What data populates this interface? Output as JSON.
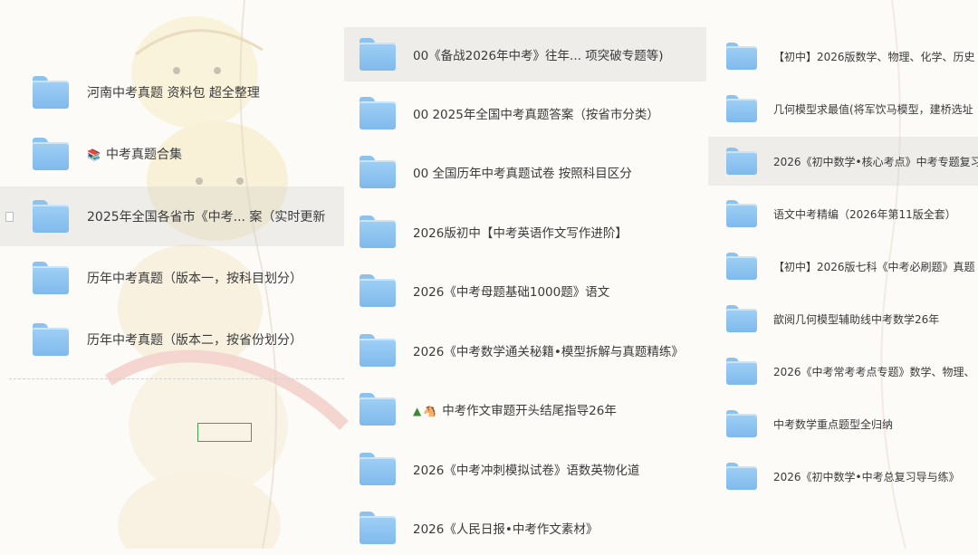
{
  "column1": {
    "items": [
      {
        "label": "河南中考真题 资料包  超全整理",
        "selected": false
      },
      {
        "label": "中考真题合集",
        "icon": "books-emoji",
        "selected": false
      },
      {
        "label": "2025年全国各省市《中考...  案（实时更新",
        "selected": true
      },
      {
        "label": "历年中考真题（版本一，按科目划分）",
        "selected": false
      },
      {
        "label": "历年中考真题（版本二，按省份划分）",
        "selected": false
      }
    ]
  },
  "column2": {
    "items": [
      {
        "label": "00《备战2026年中考》往年...  项突破专题等)",
        "selected": true
      },
      {
        "label": "00  2025年全国中考真题答案（按省市分类）",
        "selected": false
      },
      {
        "label": "00  全国历年中考真题试卷  按照科目区分",
        "selected": false
      },
      {
        "label": "2026版初中【中考英语作文写作进阶】",
        "selected": false
      },
      {
        "label": "2026《中考母题基础1000题》语文",
        "selected": false
      },
      {
        "label": "2026《中考数学通关秘籍•模型拆解与真题精练》",
        "selected": false
      },
      {
        "label": "中考作文审题开头结尾指导26年",
        "icon": "tree-horse-emoji",
        "selected": false
      },
      {
        "label": "2026《中考冲刺模拟试卷》语数英物化道",
        "selected": false
      },
      {
        "label": "2026《人民日报•中考作文素材》",
        "selected": false
      }
    ]
  },
  "column3": {
    "items": [
      {
        "label": "【初中】2026版数学、物理、化学、历史",
        "selected": false
      },
      {
        "label": "几何模型求最值(将军饮马模型，建桥选址",
        "selected": false
      },
      {
        "label": "2026《初中数学•核心考点》中考专题复习",
        "selected": true
      },
      {
        "label": "语文中考精编（2026年第11版全套）",
        "selected": false
      },
      {
        "label": "【初中】2026版七科《中考必刷题》真题",
        "selected": false
      },
      {
        "label": "歆阅几何模型辅助线中考数学26年",
        "selected": false
      },
      {
        "label": "2026《中考常考考点专题》数学、物理、",
        "selected": false
      },
      {
        "label": "中考数学重点题型全归纳",
        "selected": false
      },
      {
        "label": "2026《初中数学•中考总复习导与练》",
        "selected": false
      }
    ]
  },
  "colors": {
    "folder": "#8cc3ee",
    "selection": "#e6e6e6",
    "green_box": "#3fa34d"
  }
}
